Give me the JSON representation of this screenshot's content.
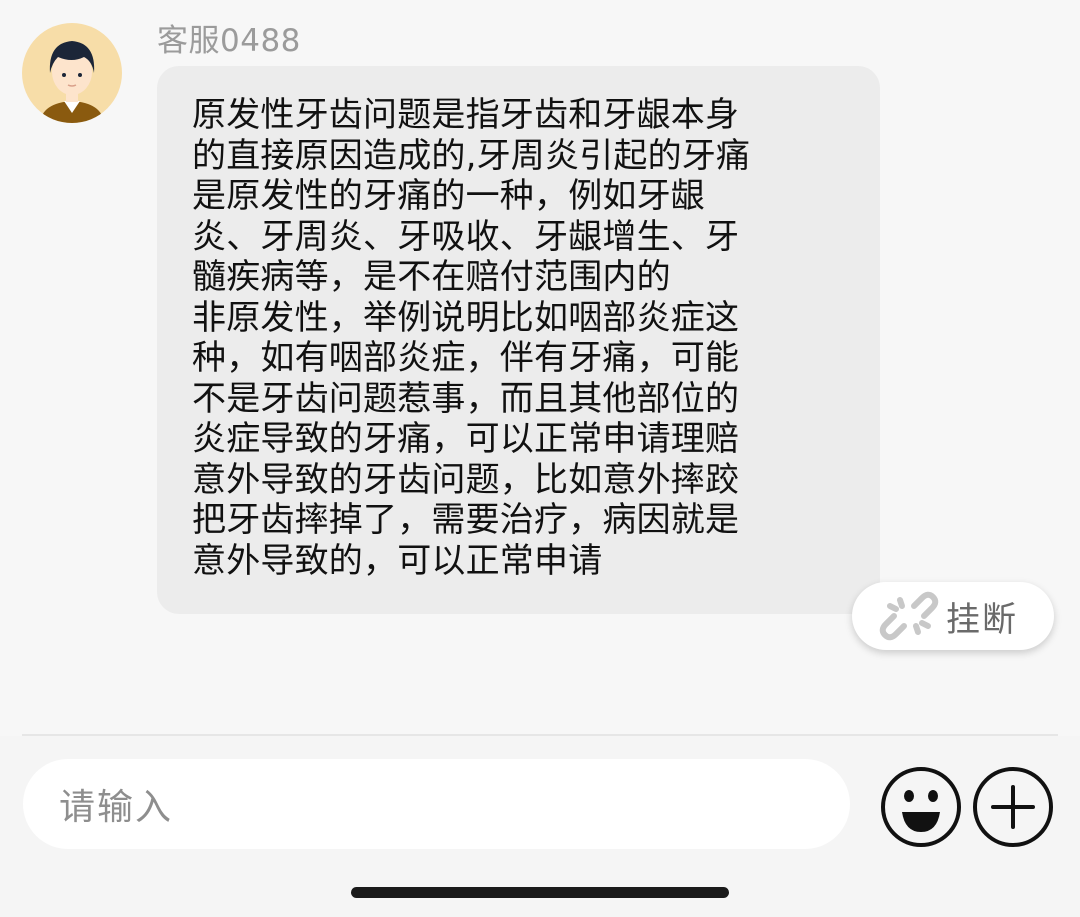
{
  "message": {
    "sender": "客服0488",
    "lines": [
      "原发性牙齿问题是指牙齿和牙龈本身",
      "的直接原因造成的,牙周炎引起的牙痛",
      "是原发性的牙痛的一种，例如牙龈",
      "炎、牙周炎、牙吸收、牙龈增生、牙",
      "髓疾病等，是不在赔付范围内的",
      "非原发性，举例说明比如咽部炎症这",
      "种，如有咽部炎症，伴有牙痛，可能",
      "不是牙齿问题惹事，而且其他部位的",
      "炎症导致的牙痛，可以正常申请理赔",
      "意外导致的牙齿问题，比如意外摔跤",
      "把牙齿摔掉了，需要治疗，病因就是",
      "意外导致的，可以正常申请"
    ]
  },
  "hangup": {
    "label": "挂断",
    "icon": "broken-link-icon"
  },
  "input": {
    "placeholder": "请输入"
  },
  "icons": {
    "emoji": "smiley-face-icon",
    "plus": "plus-icon"
  },
  "colors": {
    "bubble": "#ececec",
    "avatar_bg": "#f7dda8"
  }
}
